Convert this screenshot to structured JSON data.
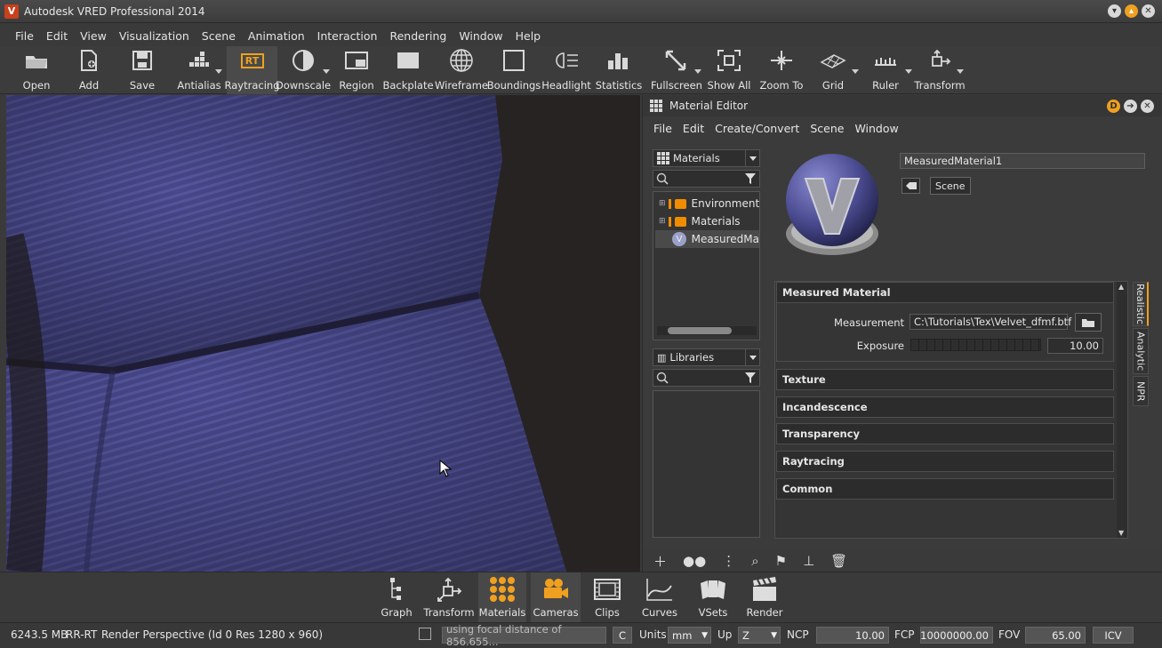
{
  "window": {
    "title": "Autodesk VRED Professional 2014",
    "logo_letter": "V"
  },
  "menu": [
    "File",
    "Edit",
    "View",
    "Visualization",
    "Scene",
    "Animation",
    "Interaction",
    "Rendering",
    "Window",
    "Help"
  ],
  "toolbar": {
    "open": "Open",
    "add": "Add",
    "save": "Save",
    "antialias": "Antialias",
    "raytracing": "Raytracing",
    "rt_badge": "RT",
    "downscale": "Downscale",
    "region": "Region",
    "backplate": "Backplate",
    "wireframe": "Wireframe",
    "boundings": "Boundings",
    "headlight": "Headlight",
    "statistics": "Statistics",
    "fullscreen": "Fullscreen",
    "show_all": "Show All",
    "zoom_to": "Zoom To",
    "grid": "Grid",
    "ruler": "Ruler",
    "transform": "Transform"
  },
  "material_editor": {
    "title": "Material Editor",
    "menu": [
      "File",
      "Edit",
      "Create/Convert",
      "Scene",
      "Window"
    ],
    "materials_combo": "Materials",
    "tree": [
      "Environment",
      "Materials",
      "MeasuredMa"
    ],
    "libraries_combo": "Libraries",
    "material_name": "MeasuredMaterial1",
    "scene_button": "Scene",
    "sections": {
      "measured": "Measured Material",
      "texture": "Texture",
      "incandescence": "Incandescence",
      "transparency": "Transparency",
      "raytracing": "Raytracing",
      "common": "Common"
    },
    "measurement_label": "Measurement",
    "measurement_value": "C:\\Tutorials\\Tex\\Velvet_dfmf.btf",
    "exposure_label": "Exposure",
    "exposure_value": "10.00",
    "tabs": [
      "Realistic",
      "Analytic",
      "NPR"
    ]
  },
  "dock": [
    "Graph",
    "Transform",
    "Materials",
    "Cameras",
    "Clips",
    "Curves",
    "VSets",
    "Render"
  ],
  "status": {
    "memory": "6243.5 MB",
    "mode": "RR-RT",
    "render_info": "Render Perspective (Id 0 Res 1280 x 960)",
    "focal_msg": "using focal distance of 856.655...",
    "c_button": "C",
    "units_label": "Units",
    "units_value": "mm",
    "up_label": "Up",
    "up_value": "Z",
    "ncp_label": "NCP",
    "ncp_value": "10.00",
    "fcp_label": "FCP",
    "fcp_value": "10000000.00",
    "fov_label": "FOV",
    "fov_value": "65.00",
    "icv_button": "ICV"
  },
  "colors": {
    "accent": "#f0a020",
    "brand": "#c8401c",
    "velvet": "#4a4a8a"
  }
}
